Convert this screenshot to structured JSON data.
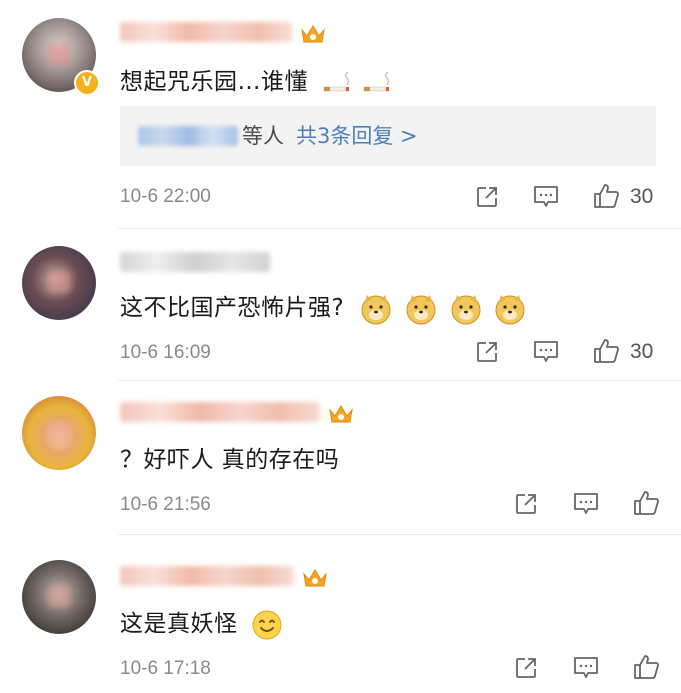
{
  "comments": [
    {
      "text": "想起咒乐园…谁懂",
      "reply_summary": "等人",
      "reply_link": "共3条回复 >",
      "time": "10-6 22:00",
      "likes": "30",
      "verified": true,
      "member_crown": true,
      "text_emoji": "cigarette-icon"
    },
    {
      "text": "这不比国产恐怖片强?",
      "time": "10-6 16:09",
      "likes": "30",
      "text_emoji": "doge-icon"
    },
    {
      "text": "？好吓人 真的存在吗",
      "time": "10-6 21:56",
      "likes": "",
      "member_crown": true
    },
    {
      "text": "这是真妖怪",
      "time": "10-6 17:18",
      "likes": "",
      "member_crown": true,
      "text_emoji": "smile-icon"
    }
  ],
  "colors": {
    "link": "#4f7fba",
    "meta": "#8a8a8a",
    "reply_bg": "#f3f3f3",
    "crown": "#f6a623",
    "verified_badge": "#f6b11a"
  }
}
